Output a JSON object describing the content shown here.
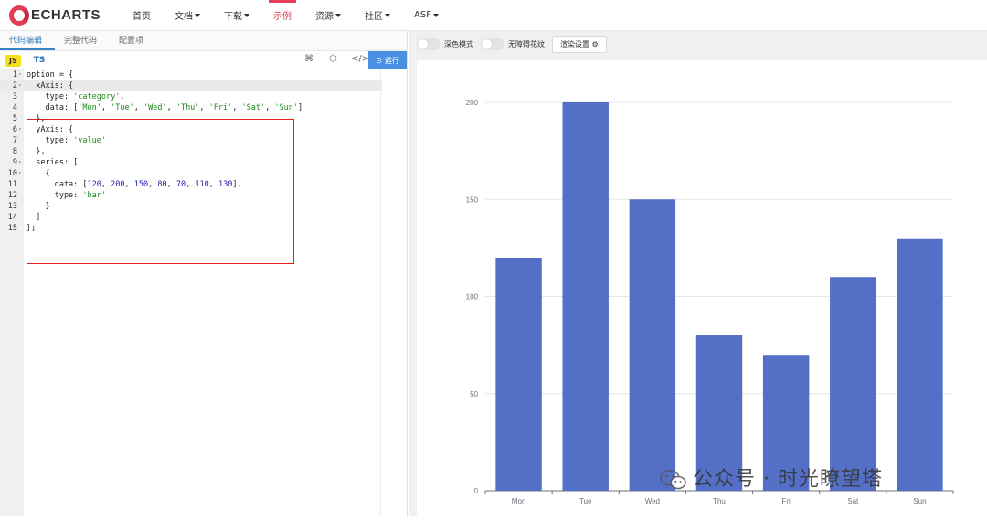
{
  "brand": {
    "name": "ECHARTS",
    "accent": "#e43c59"
  },
  "nav": [
    {
      "label": "首页",
      "dropdown": false,
      "active": false
    },
    {
      "label": "文档",
      "dropdown": true,
      "active": false
    },
    {
      "label": "下载",
      "dropdown": true,
      "active": false
    },
    {
      "label": "示例",
      "dropdown": false,
      "active": true
    },
    {
      "label": "资源",
      "dropdown": true,
      "active": false
    },
    {
      "label": "社区",
      "dropdown": true,
      "active": false
    },
    {
      "label": "ASF",
      "dropdown": true,
      "active": false
    }
  ],
  "editor": {
    "tabs": [
      "代码编辑",
      "完整代码",
      "配置项"
    ],
    "lang_js": "JS",
    "lang_ts": "TS",
    "run_label": "运行",
    "code_lines": [
      "option = {",
      "  xAxis: {",
      "    type: 'category',",
      "    data: ['Mon', 'Tue', 'Wed', 'Thu', 'Fri', 'Sat', 'Sun']",
      "  },",
      "  yAxis: {",
      "    type: 'value'",
      "  },",
      "  series: [",
      "    {",
      "      data: [120, 200, 150, 80, 70, 110, 130],",
      "      type: 'bar'",
      "    }",
      "  ]",
      "};"
    ]
  },
  "preview": {
    "dark_mode_label": "深色模式",
    "a11y_label": "无障碍花纹",
    "render_settings_label": "渲染设置 ⚙"
  },
  "watermark": "公众号 · 时光瞭望塔",
  "chart_data": {
    "type": "bar",
    "categories": [
      "Mon",
      "Tue",
      "Wed",
      "Thu",
      "Fri",
      "Sat",
      "Sun"
    ],
    "values": [
      120,
      200,
      150,
      80,
      70,
      110,
      130
    ],
    "ylim": [
      0,
      200
    ],
    "yticks": [
      0,
      50,
      100,
      150,
      200
    ],
    "bar_color": "#5470c6",
    "grid": true
  }
}
